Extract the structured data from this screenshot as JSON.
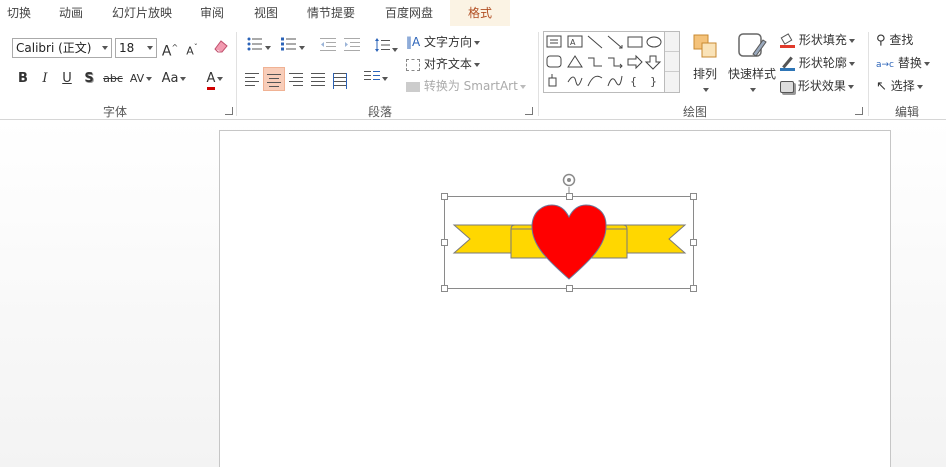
{
  "tabs": [
    {
      "label": "切换"
    },
    {
      "label": "动画"
    },
    {
      "label": "幻灯片放映"
    },
    {
      "label": "审阅"
    },
    {
      "label": "视图"
    },
    {
      "label": "情节提要"
    },
    {
      "label": "百度网盘"
    },
    {
      "label": "格式",
      "active": true
    }
  ],
  "font": {
    "name": "Calibri (正文)",
    "size": "18",
    "grow_label": "A",
    "shrink_label": "A",
    "bold": "B",
    "italic": "I",
    "underline": "U",
    "shadow": "S",
    "strike": "abc",
    "spacing": "AV",
    "case": "Aa",
    "color_label": "A",
    "color": "#d00000",
    "group_label": "字体"
  },
  "paragraph": {
    "text_direction": "文字方向",
    "align_text": "对齐文本",
    "smartart": "转换为 SmartArt",
    "group_label": "段落"
  },
  "drawing": {
    "arrange": "排列",
    "quick_styles": "快速样式",
    "shape_fill": "形状填充",
    "shape_outline": "形状轮廓",
    "shape_effects": "形状效果",
    "group_label": "绘图"
  },
  "editing": {
    "find": "查找",
    "replace": "替换",
    "select": "选择",
    "group_label": "编辑"
  },
  "colors": {
    "accent_tab_bg": "#fbf3e4",
    "selected_button": "#f8cdb9",
    "heart_fill": "#ff0000",
    "ribbon_fill": "#ffd700"
  }
}
